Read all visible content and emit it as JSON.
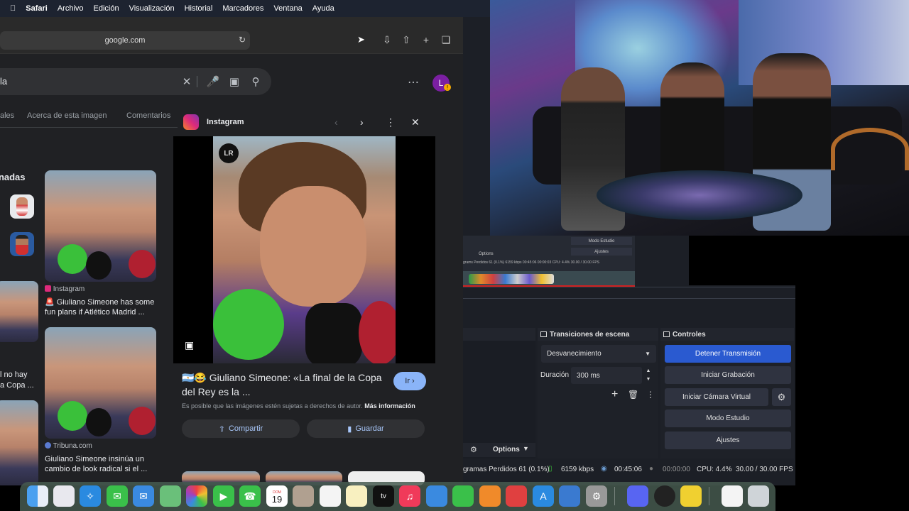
{
  "menubar": {
    "apple": "",
    "items": [
      "Safari",
      "Archivo",
      "Edición",
      "Visualización",
      "Historial",
      "Marcadores",
      "Ventana",
      "Ayuda"
    ]
  },
  "browser": {
    "url": "google.com",
    "search_text": "la",
    "tabs": [
      "ales",
      "Acerca de esta imagen",
      "Comentarios"
    ],
    "related_heading": "onadas",
    "avatar_letter": "L",
    "avatar_badge": "!",
    "results": [
      {
        "source": "Instagram",
        "title": "🚨 Giuliano Simeone has some fun plans if Atlético Madrid ..."
      },
      {
        "source": "Tribuna.com",
        "title": "Giuliano Simeone insinúa un cambio de look radical si el ..."
      }
    ],
    "left_snippet": [
      "l no hay",
      "a Copa ..."
    ],
    "panel": {
      "site": "Instagram",
      "caption": "🇦🇷😂 Giuliano Simeone: «La final de la Copa del Rey es la ...",
      "ir_label": "Ir",
      "copyright": "Es posible que las imágenes estén sujetas a derechos de autor.",
      "more_info": "Más información",
      "share_label": "Compartir",
      "save_label": "Guardar",
      "logo_text": "LR"
    }
  },
  "obs": {
    "mini_buttons": [
      "Modo Estudio",
      "Ajustes"
    ],
    "mini_options": "Options",
    "mini_status": "grams Perdidos 61 (0.1%)   6159 kbps   00:45:06   00:00:03   CPU: 4.4%   30.00 / 30.00 FPS",
    "transitions_title": "Transiciones de escena",
    "transition_value": "Desvanecimiento",
    "duration_label": "Duración",
    "duration_value": "300 ms",
    "controls_title": "Controles",
    "controls": [
      "Detener Transmisión",
      "Iniciar Grabación",
      "Iniciar Cámara Virtual",
      "Modo Estudio",
      "Ajustes"
    ],
    "options_label": "Options",
    "status": {
      "dropped": "gramas Perdidos 61 (0.1%)",
      "bitrate": "6159 kbps",
      "stream_time": "00:45:06",
      "rec_time": "00:00:00",
      "cpu": "CPU: 4.4%",
      "fps": "30.00 / 30.00 FPS"
    }
  },
  "dock": {
    "calendar_month": "DOM",
    "calendar_day": "19",
    "tv_label": "tv"
  }
}
